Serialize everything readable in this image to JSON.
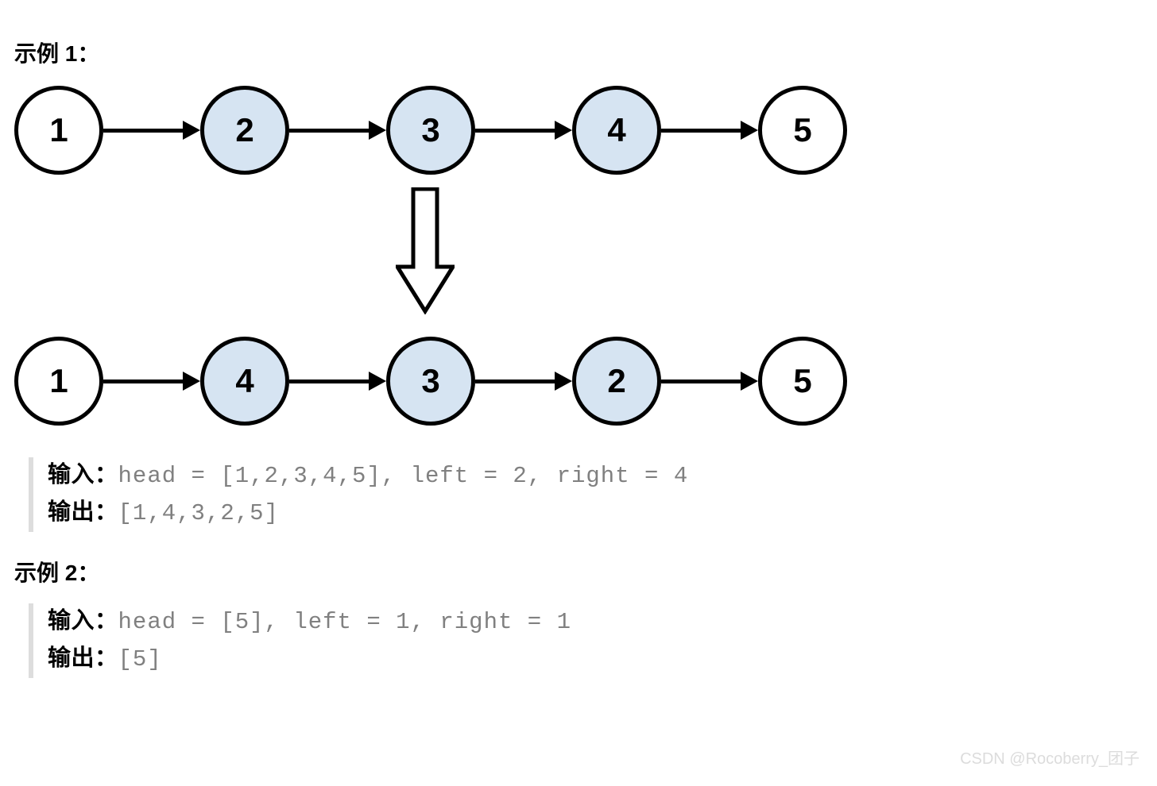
{
  "example1": {
    "title": "示例 1：",
    "before": [
      {
        "value": "1",
        "shaded": false
      },
      {
        "value": "2",
        "shaded": true
      },
      {
        "value": "3",
        "shaded": true
      },
      {
        "value": "4",
        "shaded": true
      },
      {
        "value": "5",
        "shaded": false
      }
    ],
    "after": [
      {
        "value": "1",
        "shaded": false
      },
      {
        "value": "4",
        "shaded": true
      },
      {
        "value": "3",
        "shaded": true
      },
      {
        "value": "2",
        "shaded": true
      },
      {
        "value": "5",
        "shaded": false
      }
    ],
    "input_label": "输入：",
    "input_value": "head = [1,2,3,4,5], left = 2, right = 4",
    "output_label": "输出：",
    "output_value": "[1,4,3,2,5]"
  },
  "example2": {
    "title": "示例 2：",
    "input_label": "输入：",
    "input_value": "head = [5], left = 1, right = 1",
    "output_label": "输出：",
    "output_value": "[5]"
  },
  "watermark": "CSDN @Rocoberry_团子"
}
